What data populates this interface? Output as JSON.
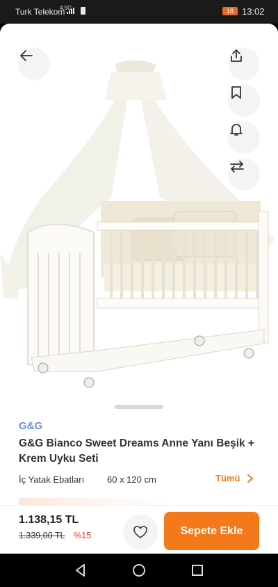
{
  "status_bar": {
    "carrier": "Turk Telekom",
    "network": "4.5G",
    "battery": "18",
    "time": "13:02"
  },
  "product": {
    "brand": "G&G",
    "title": "G&G Bianco Sweet Dreams Anne Yanı Beşik + Krem Uyku Seti",
    "attribute_label": "İç Yatak Ebatları",
    "attribute_value": "60 x 120 cm",
    "all_link": "Tümü"
  },
  "purchase": {
    "price": "1.138,15 TL",
    "old_price": "1.339,00 TL",
    "discount": "%15",
    "add_to_cart": "Sepete Ekle"
  },
  "icons": {
    "back": "arrow-left-icon",
    "share": "share-icon",
    "bookmark": "bookmark-icon",
    "alarm": "bell-icon",
    "compare": "swap-arrows-icon",
    "favorite": "heart-icon"
  },
  "colors": {
    "accent": "#f27a1a",
    "brand": "#6b8fd8",
    "discount": "#e03030"
  }
}
